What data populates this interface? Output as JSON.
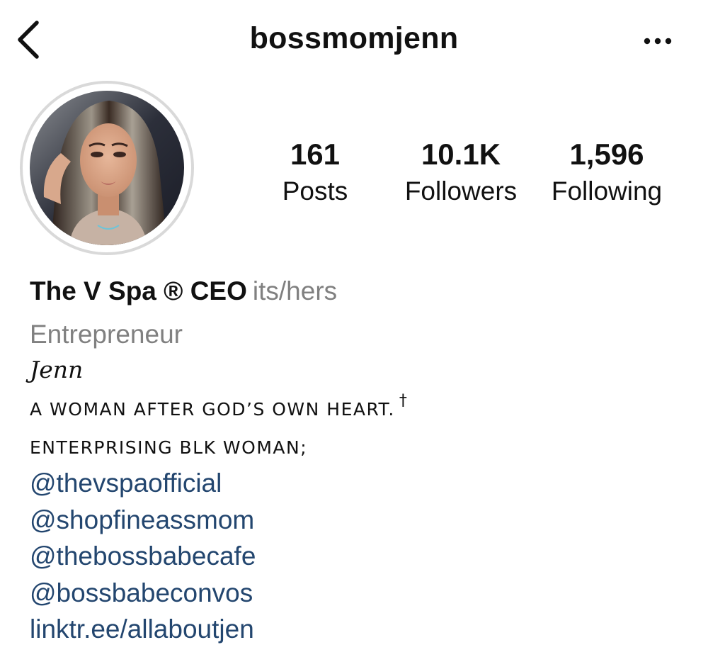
{
  "header": {
    "username": "bossmomjenn",
    "back_icon": "chevron-left-icon",
    "more_icon": "more-horizontal-icon"
  },
  "profile": {
    "avatar": "profile-photo",
    "stats": [
      {
        "value": "161",
        "label": "Posts"
      },
      {
        "value": "10.1K",
        "label": "Followers"
      },
      {
        "value": "1,596",
        "label": "Following"
      }
    ]
  },
  "bio": {
    "display_name": "The V Spa ® CEO",
    "pronouns": "its/hers",
    "category": "Entrepreneur",
    "script_name": "Jenn",
    "line1": "A WOMAN AFTER GOD’S OWN HEART.",
    "line1_symbol": "†",
    "line2": "ENTERPRISING BLK WOMAN;",
    "links": [
      "@thevspaofficial",
      "@shopfineassmom",
      "@thebossbabecafe",
      "@bossbabeconvos",
      "linktr.ee/allaboutjen"
    ]
  },
  "colors": {
    "background": "#ffffff",
    "text": "#111111",
    "secondary_text": "#808080",
    "link": "#23466f",
    "avatar_ring": "#d9d9d9"
  }
}
